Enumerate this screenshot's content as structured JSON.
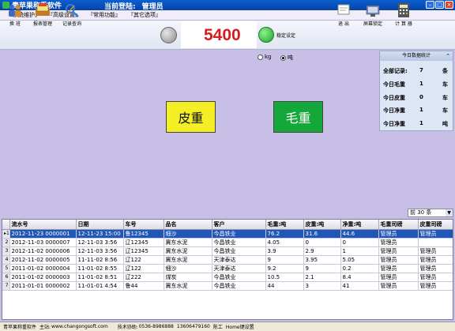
{
  "window": {
    "title": "青苹果称重软件",
    "login_label": "当前登陆:",
    "login_user": "管理员"
  },
  "menu": [
    "『系统维护』",
    "『高级设置』",
    "『常用功能』",
    "『其它选项』"
  ],
  "toolbar": {
    "left": [
      {
        "label": "换 班",
        "icon": "people-icon"
      },
      {
        "label": "报表管理",
        "icon": "report-icon"
      },
      {
        "label": "记录查询",
        "icon": "query-icon"
      }
    ],
    "right": [
      {
        "label": "退 出",
        "icon": "exit-icon"
      },
      {
        "label": "屏幕锁定",
        "icon": "lock-screen-icon"
      },
      {
        "label": "计 算 器",
        "icon": "calculator-icon"
      }
    ]
  },
  "scale": {
    "weight": "5400",
    "stable_label": "稳定设定"
  },
  "units": {
    "kg": "kg",
    "ton": "吨",
    "selected": "ton"
  },
  "stats": {
    "title": "今日数据统计",
    "rows": [
      {
        "label": "全部记录:",
        "value": "7",
        "unit": "条"
      },
      {
        "label": "今日毛重",
        "value": "1",
        "unit": "车"
      },
      {
        "label": "今日皮重",
        "value": "0",
        "unit": "车"
      },
      {
        "label": "今日净重",
        "value": "1",
        "unit": "车"
      },
      {
        "label": "今日净重",
        "value": "1",
        "unit": "吨"
      }
    ]
  },
  "buttons": {
    "tare": "皮重",
    "gross": "毛重"
  },
  "pager": "前 30 条",
  "table": {
    "columns": [
      "流水号",
      "日期",
      "车号",
      "品名",
      "客户",
      "毛重:吨",
      "皮重:吨",
      "净重:吨",
      "毛重司磅",
      "皮重司磅"
    ],
    "rows": [
      [
        "2012-11-23 0000001",
        "12-11-23 15:00",
        "鲁12345",
        "细沙",
        "今昌铁业",
        "76.2",
        "31.6",
        "44.6",
        "管理员",
        "管理员"
      ],
      [
        "2012-11-03 0000007",
        "12-11-03 3:56",
        "辽12345",
        "冀东水泥",
        "今昌铁业",
        "4.05",
        "0",
        "0",
        "管理员",
        ""
      ],
      [
        "2012-11-02 0000006",
        "12-11-03 3:56",
        "辽12345",
        "冀东水泥",
        "今昌铁业",
        "3.9",
        "2.9",
        "1",
        "管理员",
        "管理员"
      ],
      [
        "2012-11-02 0000005",
        "11-11-02 8:56",
        "辽122",
        "冀东水泥",
        "天津泰达",
        "9",
        "3.95",
        "5.05",
        "管理员",
        "管理员"
      ],
      [
        "2011-01-02 0000004",
        "11-01-02 8:55",
        "辽122",
        "细沙",
        "天津泰达",
        "9.2",
        "9",
        "0.2",
        "管理员",
        "管理员"
      ],
      [
        "2011-01-02 0000003",
        "11-01-02 8:51",
        "辽222",
        "煤炭",
        "今昌铁业",
        "10.5",
        "2.1",
        "8.4",
        "管理员",
        "管理员"
      ],
      [
        "2011-01-01 0000002",
        "11-01-01 4:54",
        "鲁44",
        "冀东水泥",
        "今昌铁业",
        "44",
        "3",
        "41",
        "管理员",
        "管理员"
      ]
    ]
  },
  "status": {
    "app": "青苹果称重软件",
    "site_label": "主站:",
    "site": "www.changongsoft.com",
    "support_label": "技术协助:",
    "phone": "0536-8986888",
    "mobile": "13606479160",
    "person": "陈工",
    "hotkey": "Home键设置"
  }
}
